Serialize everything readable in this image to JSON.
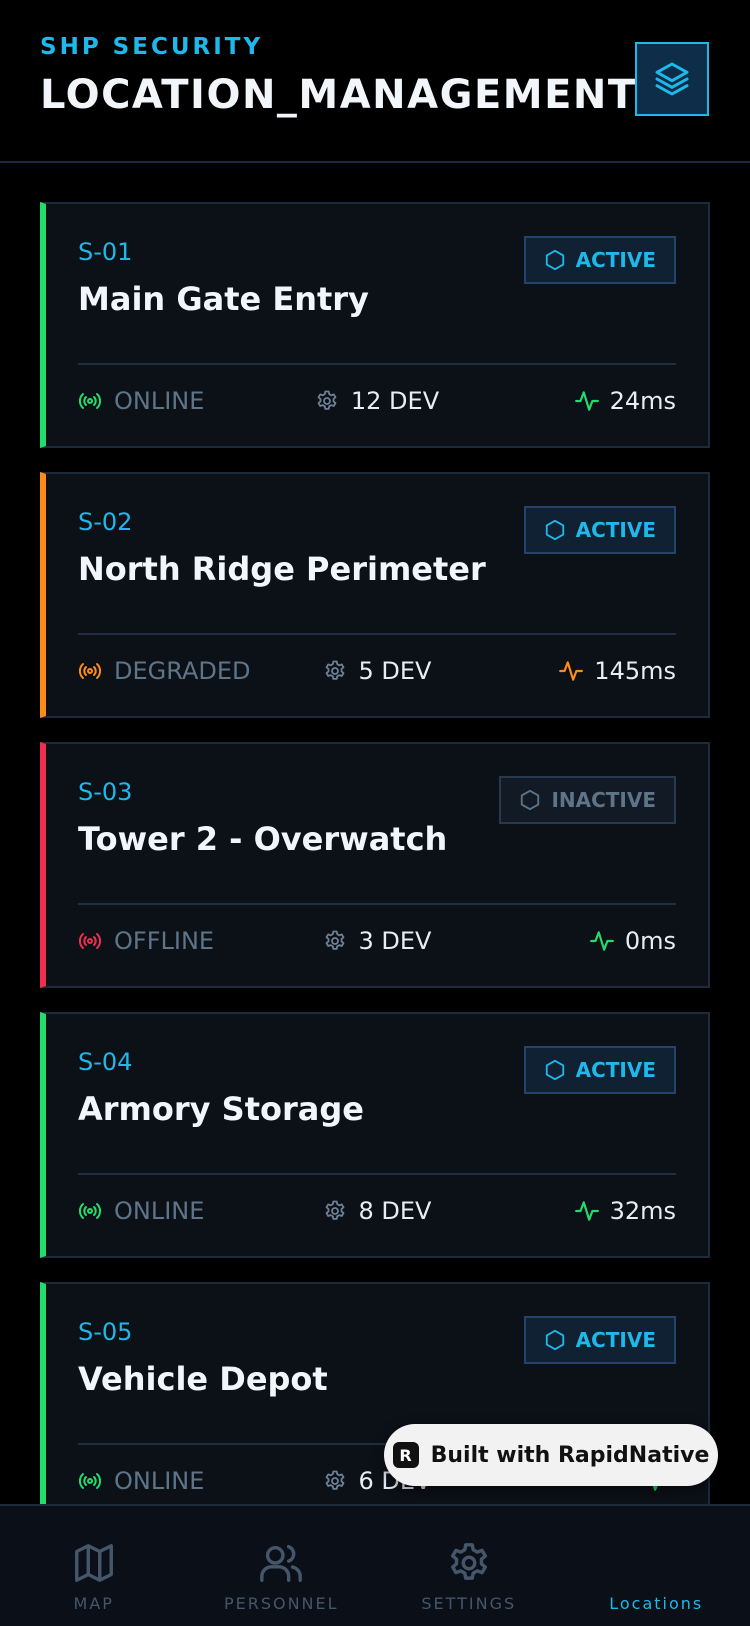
{
  "header": {
    "brand": "SHP SECURITY",
    "title": "LOCATION_MANAGEMENT",
    "action_icon": "layers-icon"
  },
  "colors": {
    "accent": "#1fb8ea",
    "online": "#22dd6e",
    "degraded": "#ff8c1a",
    "offline": "#ef2f52",
    "muted": "#5e7489",
    "card_bg": "#0c1017"
  },
  "sites": [
    {
      "id": "S-01",
      "name": "Main Gate Entry",
      "badge": "ACTIVE",
      "status": "ONLINE",
      "devices": "12 DEV",
      "latency": "24ms"
    },
    {
      "id": "S-02",
      "name": "North Ridge Perimeter",
      "badge": "ACTIVE",
      "status": "DEGRADED",
      "devices": "5 DEV",
      "latency": "145ms"
    },
    {
      "id": "S-03",
      "name": "Tower 2 - Overwatch",
      "badge": "INACTIVE",
      "status": "OFFLINE",
      "devices": "3 DEV",
      "latency": "0ms"
    },
    {
      "id": "S-04",
      "name": "Armory Storage",
      "badge": "ACTIVE",
      "status": "ONLINE",
      "devices": "8 DEV",
      "latency": "32ms"
    },
    {
      "id": "S-05",
      "name": "Vehicle Depot",
      "badge": "ACTIVE",
      "status": "ONLINE",
      "devices": "6 DEV",
      "latency": ""
    }
  ],
  "built_with": "Built with RapidNative",
  "nav": [
    {
      "label": "MAP",
      "icon": "map-icon"
    },
    {
      "label": "PERSONNEL",
      "icon": "users-icon"
    },
    {
      "label": "SETTINGS",
      "icon": "settings-icon"
    },
    {
      "label": "Locations",
      "icon": "location-icon"
    }
  ]
}
